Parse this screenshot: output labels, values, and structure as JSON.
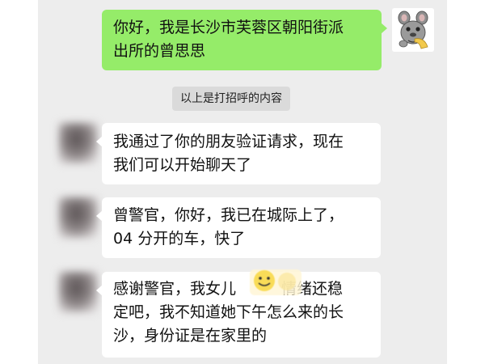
{
  "messages": [
    {
      "direction": "outgoing",
      "lines": [
        "你好，我是长沙市芙蓉区朝阳街派",
        "出所的曾思思"
      ]
    },
    {
      "direction": "system",
      "text": "以上是打招呼的内容"
    },
    {
      "direction": "incoming",
      "lines": [
        "我通过了你的朋友验证请求，现在",
        "我们可以开始聊天了"
      ]
    },
    {
      "direction": "incoming",
      "lines": [
        "曾警官，你好，我已在城际上了，",
        "04 分开的车，快了"
      ]
    },
    {
      "direction": "incoming",
      "lines": [
        "感谢警官，我女儿",
        "情绪还稳",
        "定吧，我不知道她下午怎么来的长",
        "沙，身份证是在家里的"
      ]
    }
  ],
  "colors": {
    "outgoing_bubble": "#95ec69",
    "incoming_bubble": "#ffffff",
    "chat_background": "#ededed",
    "system_notice_background": "#dadada"
  },
  "icons": {
    "self_avatar": "cartoon-mouse-icon",
    "redaction_sticker": "smiley-face-icon"
  }
}
